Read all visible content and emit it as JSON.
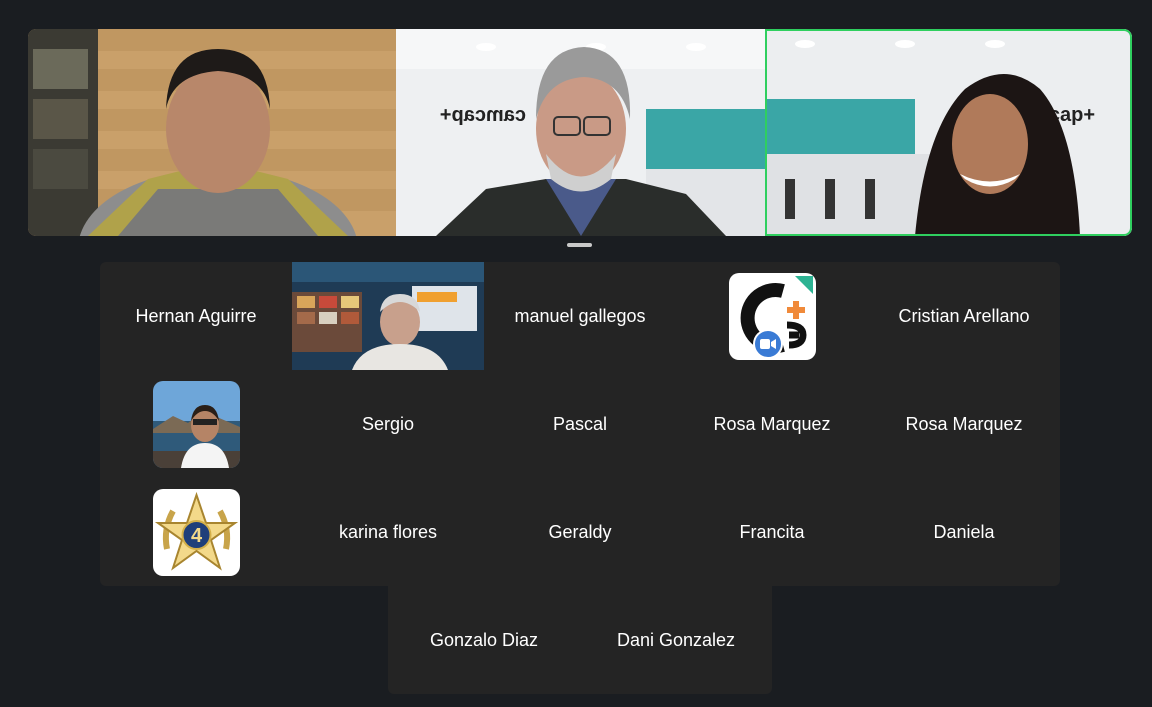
{
  "speaker_strip": {
    "videos": [
      {
        "participant_type": "video"
      },
      {
        "participant_type": "video"
      },
      {
        "participant_type": "video",
        "active_speaker": true
      }
    ],
    "logo_text": "camcap+",
    "logo_text_2": "amcap+",
    "active_color": "#2fcf5f"
  },
  "gallery": {
    "tiles": [
      {
        "name": "Hernan Aguirre"
      },
      {
        "name": "",
        "video": true
      },
      {
        "name": "manuel gallegos"
      },
      {
        "name": "",
        "avatar": "camcap-logo-icon"
      },
      {
        "name": "Cristian Arellano"
      },
      {
        "name": "",
        "avatar": "profile-photo"
      },
      {
        "name": "Sergio"
      },
      {
        "name": "Pascal"
      },
      {
        "name": "Rosa Marquez"
      },
      {
        "name": "Rosa Marquez"
      },
      {
        "name": "",
        "avatar": "star-badge-icon"
      },
      {
        "name": "karina flores"
      },
      {
        "name": "Geraldy"
      },
      {
        "name": "Francita"
      },
      {
        "name": "Daniela"
      },
      {
        "name": "Gonzalo Diaz"
      },
      {
        "name": "Dani Gonzalez"
      }
    ],
    "badge_number": "4"
  }
}
